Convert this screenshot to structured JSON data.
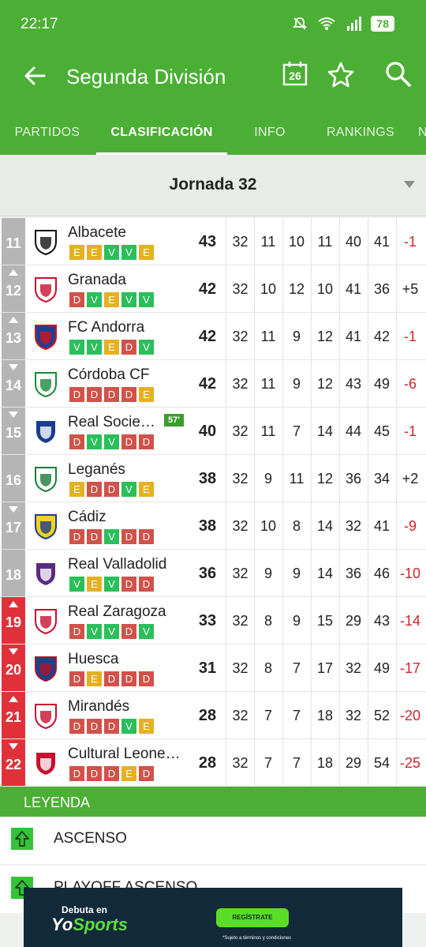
{
  "status_bar": {
    "time": "22:17",
    "battery": "78"
  },
  "app_bar": {
    "title": "Segunda División",
    "calendar_day": "26"
  },
  "tabs": [
    {
      "label": "PARTIDOS"
    },
    {
      "label": "CLASIFICACIÓN"
    },
    {
      "label": "INFO"
    },
    {
      "label": "RANKINGS"
    },
    {
      "label": "N"
    }
  ],
  "round_selector": {
    "label": "Jornada 32"
  },
  "standings": [
    {
      "pos": "11",
      "trend": "none",
      "zone": "grey",
      "team": "Albacete",
      "form": [
        "E",
        "E",
        "V",
        "V",
        "E"
      ],
      "live": "",
      "pts": "43",
      "pj": "32",
      "g": "11",
      "e": "10",
      "p": "11",
      "gf": "40",
      "gc": "41",
      "dg": "-1"
    },
    {
      "pos": "12",
      "trend": "up",
      "zone": "grey",
      "team": "Granada",
      "form": [
        "D",
        "V",
        "E",
        "V",
        "V"
      ],
      "live": "",
      "pts": "42",
      "pj": "32",
      "g": "10",
      "e": "12",
      "p": "10",
      "gf": "41",
      "gc": "36",
      "dg": "+5"
    },
    {
      "pos": "13",
      "trend": "up",
      "zone": "grey",
      "team": "FC Andorra",
      "form": [
        "V",
        "V",
        "E",
        "D",
        "V"
      ],
      "live": "",
      "pts": "42",
      "pj": "32",
      "g": "11",
      "e": "9",
      "p": "12",
      "gf": "41",
      "gc": "42",
      "dg": "-1"
    },
    {
      "pos": "14",
      "trend": "down",
      "zone": "grey",
      "team": "Córdoba CF",
      "form": [
        "D",
        "D",
        "D",
        "D",
        "E"
      ],
      "live": "",
      "pts": "42",
      "pj": "32",
      "g": "11",
      "e": "9",
      "p": "12",
      "gf": "43",
      "gc": "49",
      "dg": "-6"
    },
    {
      "pos": "15",
      "trend": "down",
      "zone": "grey",
      "team": "Real Socie…",
      "form": [
        "D",
        "V",
        "V",
        "D",
        "D"
      ],
      "live": "57'",
      "pts": "40",
      "pj": "32",
      "g": "11",
      "e": "7",
      "p": "14",
      "gf": "44",
      "gc": "45",
      "dg": "-1"
    },
    {
      "pos": "16",
      "trend": "none",
      "zone": "grey",
      "team": "Leganés",
      "form": [
        "E",
        "D",
        "D",
        "V",
        "E"
      ],
      "live": "",
      "pts": "38",
      "pj": "32",
      "g": "9",
      "e": "11",
      "p": "12",
      "gf": "36",
      "gc": "34",
      "dg": "+2"
    },
    {
      "pos": "17",
      "trend": "down",
      "zone": "grey",
      "team": "Cádiz",
      "form": [
        "D",
        "D",
        "V",
        "D",
        "D"
      ],
      "live": "",
      "pts": "38",
      "pj": "32",
      "g": "10",
      "e": "8",
      "p": "14",
      "gf": "32",
      "gc": "41",
      "dg": "-9"
    },
    {
      "pos": "18",
      "trend": "none",
      "zone": "grey",
      "team": "Real Valladolid",
      "form": [
        "V",
        "E",
        "V",
        "D",
        "D"
      ],
      "live": "",
      "pts": "36",
      "pj": "32",
      "g": "9",
      "e": "9",
      "p": "14",
      "gf": "36",
      "gc": "46",
      "dg": "-10"
    },
    {
      "pos": "19",
      "trend": "up",
      "zone": "red",
      "team": "Real Zaragoza",
      "form": [
        "D",
        "V",
        "V",
        "D",
        "V"
      ],
      "live": "",
      "pts": "33",
      "pj": "32",
      "g": "8",
      "e": "9",
      "p": "15",
      "gf": "29",
      "gc": "43",
      "dg": "-14"
    },
    {
      "pos": "20",
      "trend": "down",
      "zone": "red",
      "team": "Huesca",
      "form": [
        "D",
        "E",
        "D",
        "D",
        "D"
      ],
      "live": "",
      "pts": "31",
      "pj": "32",
      "g": "8",
      "e": "7",
      "p": "17",
      "gf": "32",
      "gc": "49",
      "dg": "-17"
    },
    {
      "pos": "21",
      "trend": "up",
      "zone": "red",
      "team": "Mirandés",
      "form": [
        "D",
        "D",
        "D",
        "V",
        "E"
      ],
      "live": "",
      "pts": "28",
      "pj": "32",
      "g": "7",
      "e": "7",
      "p": "18",
      "gf": "32",
      "gc": "52",
      "dg": "-20"
    },
    {
      "pos": "22",
      "trend": "down",
      "zone": "red",
      "team": "Cultural Leone…",
      "form": [
        "D",
        "D",
        "D",
        "E",
        "D"
      ],
      "live": "",
      "pts": "28",
      "pj": "32",
      "g": "7",
      "e": "7",
      "p": "18",
      "gf": "29",
      "gc": "54",
      "dg": "-25"
    }
  ],
  "legend": {
    "title": "LEYENDA",
    "items": [
      {
        "label": "ASCENSO"
      },
      {
        "label": "PLAYOFF ASCENSO"
      }
    ]
  },
  "ad": {
    "small": "Debuta en",
    "brand_a": "Yo",
    "brand_b": "Sports",
    "button": "REGÍSTRATE",
    "note": "*Sujeto a términos y condiciones"
  },
  "colors": {
    "primary_green": "#4caf35",
    "relegation_red": "#e0313b",
    "form_win": "#2bbf5b",
    "form_draw": "#e5b123",
    "form_loss": "#d1524a",
    "negative_text": "#d0232d"
  },
  "icons": [
    "back-arrow-icon",
    "calendar-icon",
    "star-icon",
    "search-icon",
    "mute-icon",
    "wifi-icon",
    "signal-icon",
    "battery-icon",
    "legend-up-arrow-icon"
  ]
}
